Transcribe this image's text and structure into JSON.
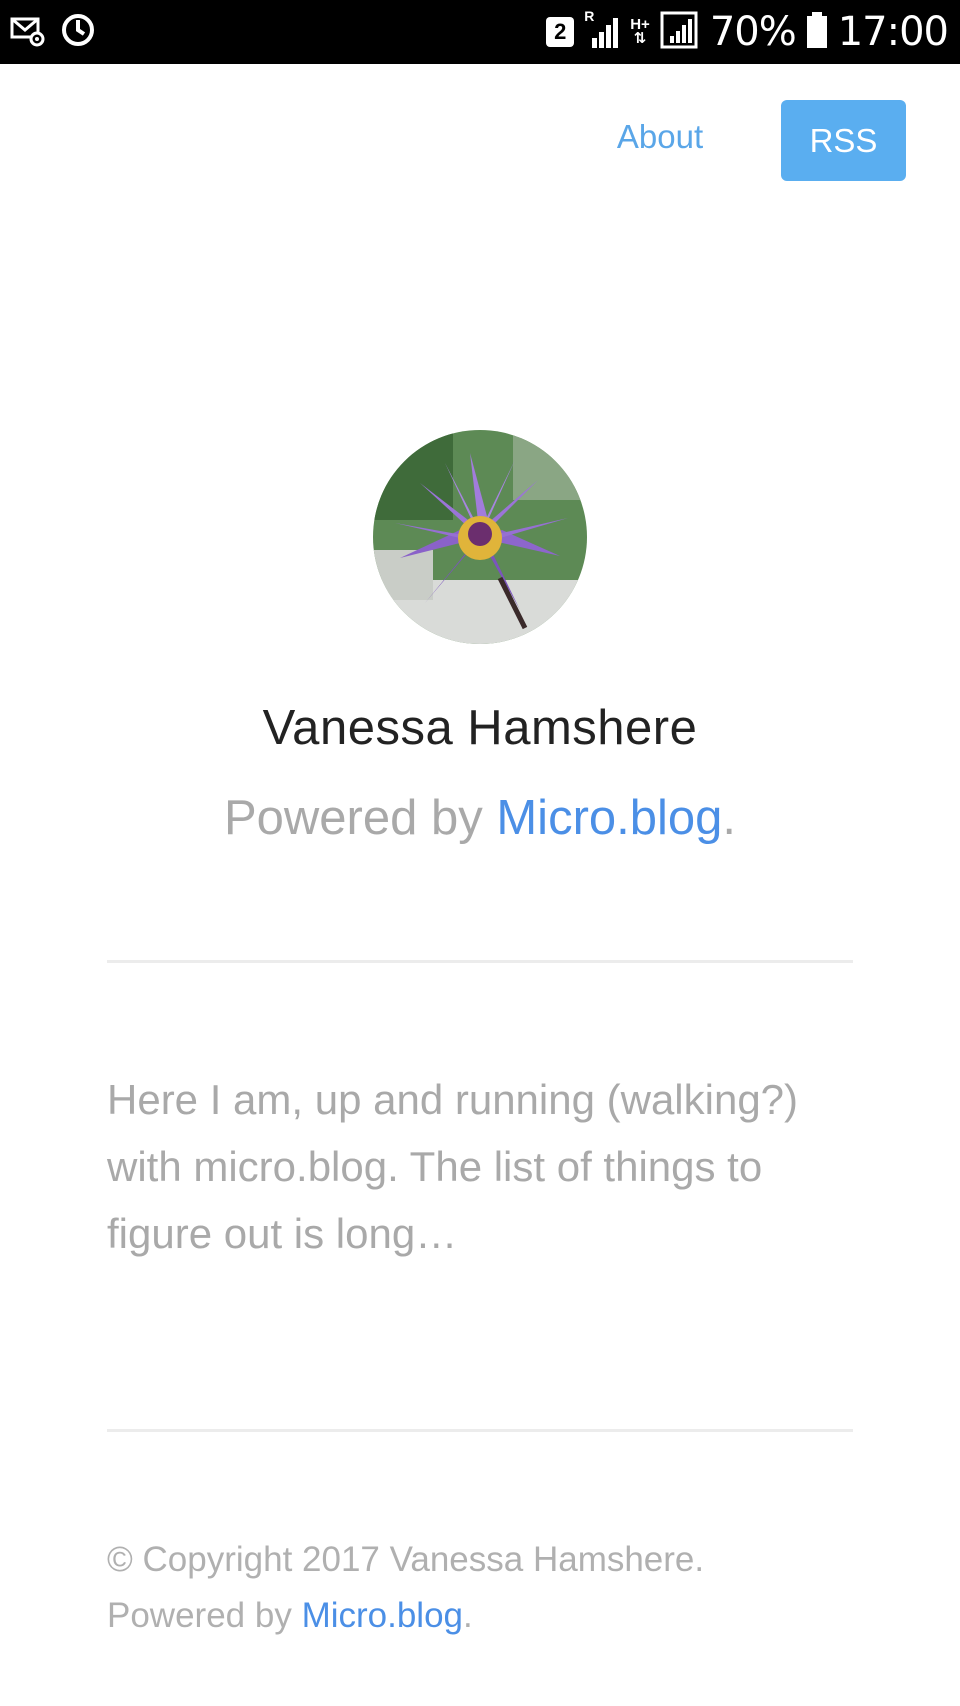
{
  "status_bar": {
    "sim_slot": "2",
    "roaming": "R",
    "network_type": "H+",
    "battery": "70%",
    "time": "17:00",
    "icons": [
      "mail-settings-icon",
      "sync-icon",
      "signal-roaming-icon",
      "signal-icon",
      "battery-icon"
    ]
  },
  "nav": {
    "about_label": "About",
    "rss_label": "RSS"
  },
  "profile": {
    "name": "Vanessa Hamshere",
    "powered_prefix": "Powered by ",
    "powered_link": "Micro.blog",
    "powered_suffix": "."
  },
  "post": {
    "text": "Here I am, up and running (walking?) with micro.blog. The list of things to figure out is long…"
  },
  "footer": {
    "copyright": "© Copyright 2017 Vanessa Hamshere.",
    "powered_prefix": "Powered by ",
    "powered_link": "Micro.blog",
    "powered_suffix": "."
  },
  "colors": {
    "accent": "#5aaef0",
    "link": "#4b8fe6",
    "muted_text": "#a9a9a9"
  }
}
